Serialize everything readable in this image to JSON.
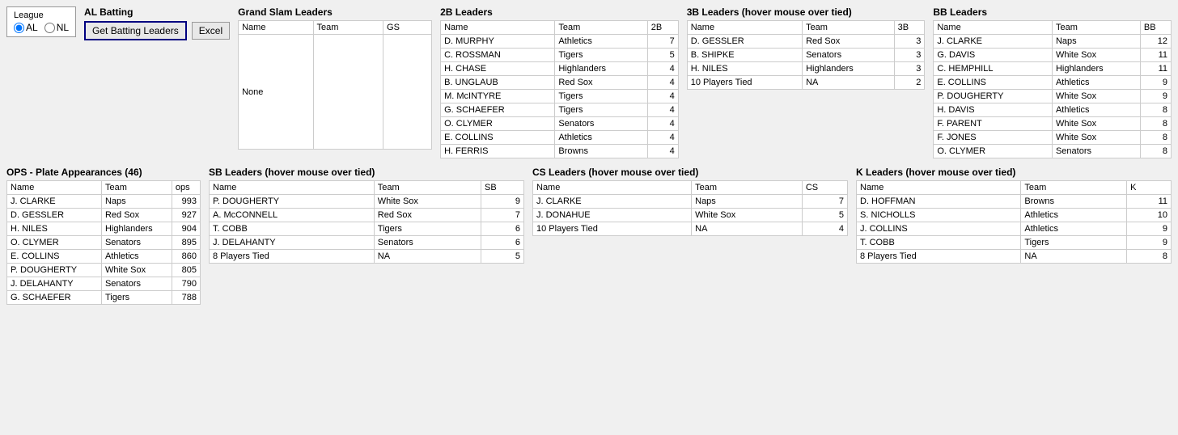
{
  "league": {
    "label": "League",
    "options": [
      "AL",
      "NL"
    ],
    "selected": "AL"
  },
  "al_batting": {
    "title": "AL Batting",
    "get_button": "Get Batting Leaders",
    "excel_button": "Excel"
  },
  "grand_slam": {
    "title": "Grand Slam Leaders",
    "columns": [
      "Name",
      "Team",
      "GS"
    ],
    "rows": [
      {
        "name": "None",
        "team": "",
        "gs": ""
      }
    ]
  },
  "two_b_leaders": {
    "title": "2B Leaders",
    "columns": [
      "Name",
      "Team",
      "2B"
    ],
    "rows": [
      {
        "name": "D. MURPHY",
        "team": "Athletics",
        "val": "7"
      },
      {
        "name": "C. ROSSMAN",
        "team": "Tigers",
        "val": "5"
      },
      {
        "name": "H. CHASE",
        "team": "Highlanders",
        "val": "4"
      },
      {
        "name": "B. UNGLAUB",
        "team": "Red Sox",
        "val": "4"
      },
      {
        "name": "M. McINTYRE",
        "team": "Tigers",
        "val": "4"
      },
      {
        "name": "G. SCHAEFER",
        "team": "Tigers",
        "val": "4"
      },
      {
        "name": "O. CLYMER",
        "team": "Senators",
        "val": "4"
      },
      {
        "name": "E. COLLINS",
        "team": "Athletics",
        "val": "4"
      },
      {
        "name": "H. FERRIS",
        "team": "Browns",
        "val": "4"
      }
    ]
  },
  "three_b_leaders": {
    "title": "3B Leaders (hover mouse over tied)",
    "columns": [
      "Name",
      "Team",
      "3B"
    ],
    "rows": [
      {
        "name": "D. GESSLER",
        "team": "Red Sox",
        "val": "3"
      },
      {
        "name": "B. SHIPKE",
        "team": "Senators",
        "val": "3"
      },
      {
        "name": "H. NILES",
        "team": "Highlanders",
        "val": "3"
      },
      {
        "name": "10 Players Tied",
        "team": "NA",
        "val": "2"
      }
    ]
  },
  "bb_leaders": {
    "title": "BB Leaders",
    "columns": [
      "Name",
      "Team",
      "BB"
    ],
    "rows": [
      {
        "name": "J. CLARKE",
        "team": "Naps",
        "val": "12"
      },
      {
        "name": "G. DAVIS",
        "team": "White Sox",
        "val": "11"
      },
      {
        "name": "C. HEMPHILL",
        "team": "Highlanders",
        "val": "11"
      },
      {
        "name": "E. COLLINS",
        "team": "Athletics",
        "val": "9"
      },
      {
        "name": "P. DOUGHERTY",
        "team": "White Sox",
        "val": "9"
      },
      {
        "name": "H. DAVIS",
        "team": "Athletics",
        "val": "8"
      },
      {
        "name": "F. PARENT",
        "team": "White Sox",
        "val": "8"
      },
      {
        "name": "F. JONES",
        "team": "White Sox",
        "val": "8"
      },
      {
        "name": "O. CLYMER",
        "team": "Senators",
        "val": "8"
      }
    ]
  },
  "ops_leaders": {
    "title": "OPS - Plate Appearances (46)",
    "columns": [
      "Name",
      "Team",
      "ops"
    ],
    "rows": [
      {
        "name": "J. CLARKE",
        "team": "Naps",
        "val": "993"
      },
      {
        "name": "D. GESSLER",
        "team": "Red Sox",
        "val": "927"
      },
      {
        "name": "H. NILES",
        "team": "Highlanders",
        "val": "904"
      },
      {
        "name": "O. CLYMER",
        "team": "Senators",
        "val": "895"
      },
      {
        "name": "E. COLLINS",
        "team": "Athletics",
        "val": "860"
      },
      {
        "name": "P. DOUGHERTY",
        "team": "White Sox",
        "val": "805"
      },
      {
        "name": "J. DELAHANTY",
        "team": "Senators",
        "val": "790"
      },
      {
        "name": "G. SCHAEFER",
        "team": "Tigers",
        "val": "788"
      }
    ]
  },
  "sb_leaders": {
    "title": "SB Leaders (hover mouse over tied)",
    "columns": [
      "Name",
      "Team",
      "SB"
    ],
    "rows": [
      {
        "name": "P. DOUGHERTY",
        "team": "White Sox",
        "val": "9"
      },
      {
        "name": "A. McCONNELL",
        "team": "Red Sox",
        "val": "7"
      },
      {
        "name": "T. COBB",
        "team": "Tigers",
        "val": "6"
      },
      {
        "name": "J. DELAHANTY",
        "team": "Senators",
        "val": "6"
      },
      {
        "name": "8 Players Tied",
        "team": "NA",
        "val": "5"
      }
    ]
  },
  "cs_leaders": {
    "title": "CS Leaders (hover mouse over tied)",
    "columns": [
      "Name",
      "Team",
      "CS"
    ],
    "rows": [
      {
        "name": "J. CLARKE",
        "team": "Naps",
        "val": "7"
      },
      {
        "name": "J. DONAHUE",
        "team": "White Sox",
        "val": "5"
      },
      {
        "name": "10 Players Tied",
        "team": "NA",
        "val": "4"
      }
    ]
  },
  "k_leaders": {
    "title": "K Leaders (hover mouse over tied)",
    "columns": [
      "Name",
      "Team",
      "K"
    ],
    "rows": [
      {
        "name": "D. HOFFMAN",
        "team": "Browns",
        "val": "11"
      },
      {
        "name": "S. NICHOLLS",
        "team": "Athletics",
        "val": "10"
      },
      {
        "name": "J. COLLINS",
        "team": "Athletics",
        "val": "9"
      },
      {
        "name": "T. COBB",
        "team": "Tigers",
        "val": "9"
      },
      {
        "name": "8 Players Tied",
        "team": "NA",
        "val": "8"
      }
    ]
  }
}
